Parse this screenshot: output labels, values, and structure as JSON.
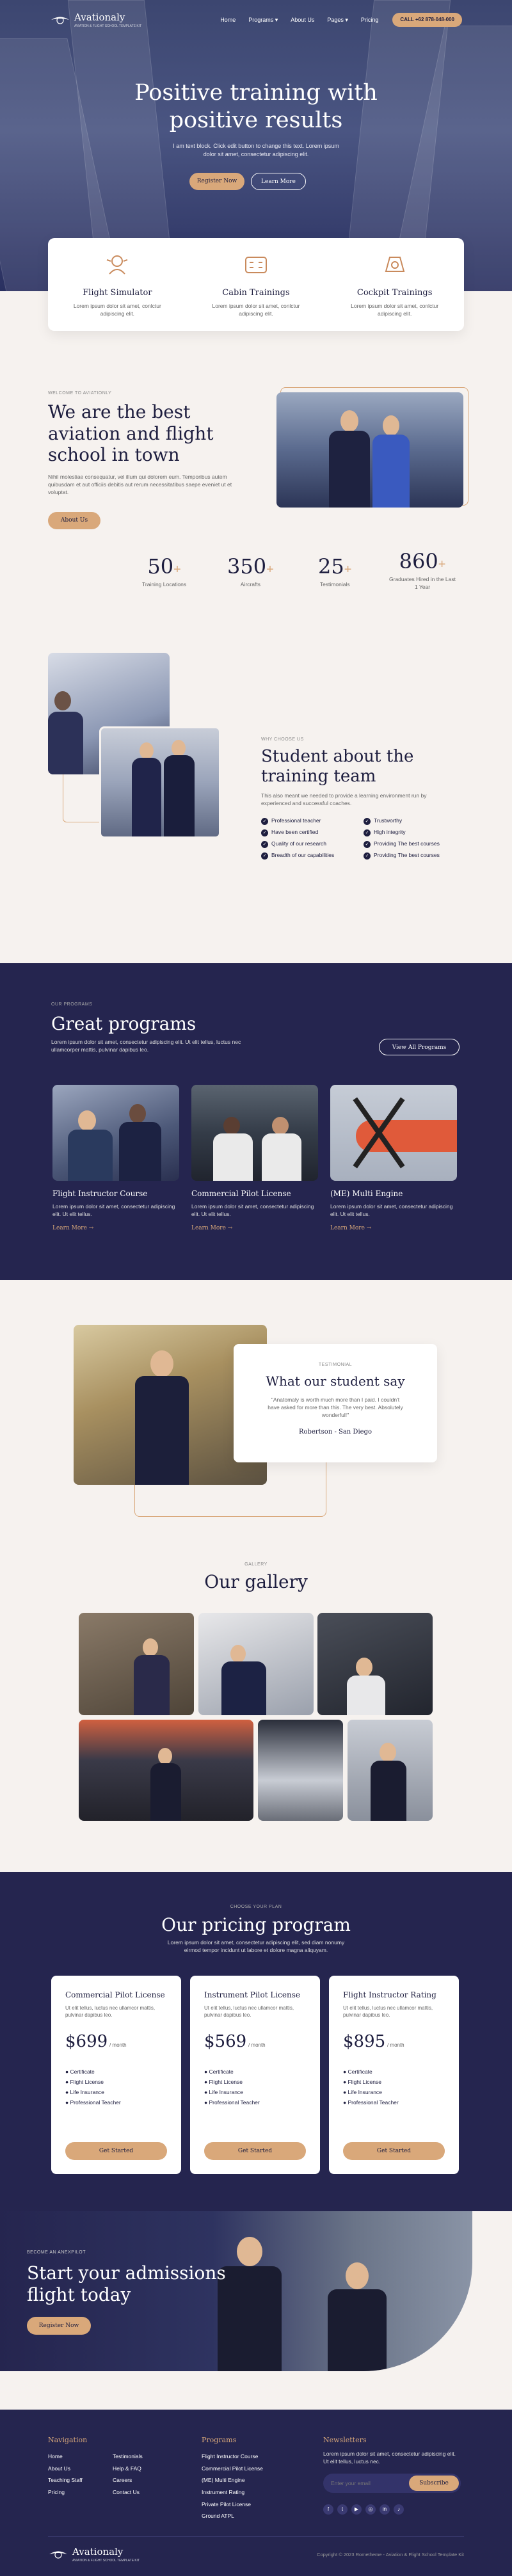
{
  "nav": {
    "logo": "Avationaly",
    "tagline": "AVIATION & FLIGHT SCHOOL TEMPLATE KIT",
    "items": [
      "Home",
      "Programs",
      "About Us",
      "Pages",
      "Pricing"
    ],
    "call": "CALL +62 878-048-000"
  },
  "hero": {
    "title_line1": "Positive training with",
    "title_line2": "positive results",
    "sub": "I am text block. Click edit button to change this text. Lorem ipsum dolor sit amet, consectetur adipiscing elit.",
    "btn_primary": "Register Now",
    "btn_secondary": "Learn More"
  },
  "features": [
    {
      "icon": "flight-simulator-icon",
      "title": "Flight Simulator",
      "text": "Lorem ipsum dolor sit amet, conlctur adipiscing elit."
    },
    {
      "icon": "cabin-icon",
      "title": "Cabin Trainings",
      "text": "Lorem ipsum dolor sit amet, conlctur adipiscing elit."
    },
    {
      "icon": "cockpit-icon",
      "title": "Cockpit Trainings",
      "text": "Lorem ipsum dolor sit amet, conlctur adipiscing elit."
    }
  ],
  "about": {
    "eyebrow": "WELCOME TO AVIATIONLY",
    "title": "We are the best aviation and flight school in town",
    "text": "Nihil molestiae consequatur, vel illum qui dolorem eum. Temporibus autem quibusdam et aut officiis debitis aut rerum necessitatibus saepe eveniet ut et voluptat.",
    "btn": "About Us"
  },
  "stats": [
    {
      "num": "50",
      "label": "Training Locations"
    },
    {
      "num": "350",
      "label": "Aircrafts"
    },
    {
      "num": "25",
      "label": "Testimonials"
    },
    {
      "num": "860",
      "label": "Graduates Hired in the Last 1 Year"
    }
  ],
  "why": {
    "eyebrow": "WHY CHOOSE US",
    "title": "Student about the training team",
    "text": "This also meant we needed to provide a learning environment run by experienced and successful coaches.",
    "list": [
      "Professional teacher",
      "Trustworthy",
      "Have been certified",
      "High integrity",
      "Quality of our research",
      "Providing The best courses",
      "Breadth of our capabilities",
      "Providing The best courses"
    ]
  },
  "programs": {
    "eyebrow": "OUR PROGRAMS",
    "title": "Great programs",
    "text": "Lorem ipsum dolor sit amet, consectetur adipiscing elit. Ut elit tellus, luctus nec ullamcorper mattis, pulvinar dapibus leo.",
    "btn": "View All Programs",
    "cards": [
      {
        "title": "Flight Instructor Course",
        "text": "Lorem ipsum dolor sit amet, consectetur adipiscing elit. Ut elit tellus.",
        "link": "Learn More"
      },
      {
        "title": "Commercial Pilot License",
        "text": "Lorem ipsum dolor sit amet, consectetur adipiscing elit. Ut elit tellus.",
        "link": "Learn More"
      },
      {
        "title": "(ME) Multi Engine",
        "text": "Lorem ipsum dolor sit amet, consectetur adipiscing elit. Ut elit tellus.",
        "link": "Learn More"
      }
    ]
  },
  "testimonial": {
    "eyebrow": "TESTIMONIAL",
    "title": "What our student say",
    "quote": "\"Anatomaly is worth much more than I paid. I couldn't have asked for more than this. The very best. Absolutely wonderful!\"",
    "author": "Robertson - San Diego"
  },
  "gallery": {
    "eyebrow": "GALLERY",
    "title": "Our gallery"
  },
  "pricing": {
    "eyebrow": "CHOOSE YOUR PLAN",
    "title": "Our pricing program",
    "text": "Lorem ipsum dolor sit amet, consectetur adipiscing elit, sed diam nonumy eirmod tempor incidunt ut labore et dolore magna aliquyam.",
    "per": "/ month",
    "features": [
      "Certificate",
      "Flight License",
      "Life Insurance",
      "Professional Teacher"
    ],
    "btn": "Get Started",
    "plans": [
      {
        "name": "Commercial Pilot License",
        "desc": "Ut elit tellus, luctus nec ullamcor mattis, pulvinar dapibus leo.",
        "price": "$699"
      },
      {
        "name": "Instrument Pilot License",
        "desc": "Ut elit tellus, luctus nec ullamcor mattis, pulvinar dapibus leo.",
        "price": "$569"
      },
      {
        "name": "Flight Instructor Rating",
        "desc": "Ut elit tellus, luctus nec ullamcor mattis, pulvinar dapibus leo.",
        "price": "$895"
      }
    ]
  },
  "cta": {
    "eyebrow": "BECOME AN ANEXPILOT",
    "title_line1": "Start your admissions",
    "title_line2": "flight today",
    "btn": "Register Now"
  },
  "footer": {
    "nav_title": "Navigation",
    "nav_col1": [
      "Home",
      "About Us",
      "Teaching Staff",
      "Pricing"
    ],
    "nav_col2": [
      "Testimonials",
      "Help & FAQ",
      "Careers",
      "Contact Us"
    ],
    "prog_title": "Programs",
    "programs": [
      "Flight Instructor Course",
      "Commercial Pilot License",
      "(ME) Multi Engine",
      "Instrument Rating",
      "Private Pilot License",
      "Ground ATPL"
    ],
    "news_title": "Newsletters",
    "news_text": "Lorem ipsum dolor sit amet, consectetur adipiscing elit. Ut elit tellus, luctus nec.",
    "email_placeholder": "Enter your email",
    "subscribe": "Subscribe",
    "logo": "Avationaly",
    "tagline": "AVIATION & FLIGHT SCHOOL TEMPLATE KIT",
    "copyright": "Copyright © 2023 Rometheme - Aviation & Flight School Template Kit"
  },
  "colors": {
    "navy": "#25254f",
    "tan": "#d9a87a",
    "cream": "#f6f2ef"
  }
}
